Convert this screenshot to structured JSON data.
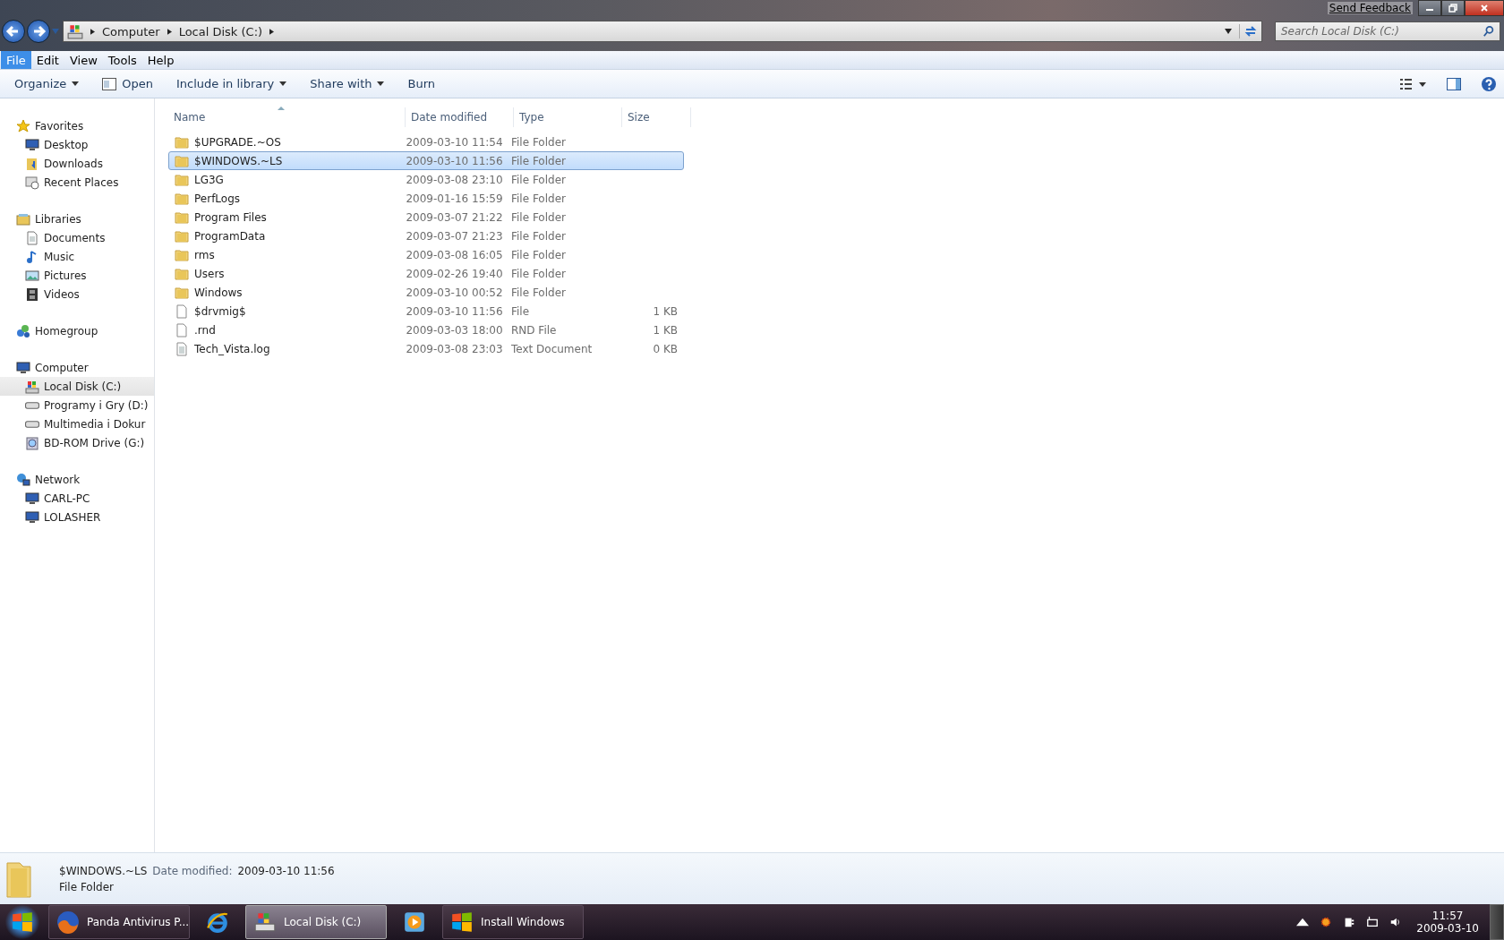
{
  "title_bar": {
    "feedback_link": "Send Feedback"
  },
  "address_bar": {
    "crumbs": [
      "Computer",
      "Local Disk (C:)"
    ]
  },
  "search": {
    "placeholder": "Search Local Disk (C:)"
  },
  "menu": [
    {
      "label": "File",
      "selected": true
    },
    {
      "label": "Edit",
      "selected": false
    },
    {
      "label": "View",
      "selected": false
    },
    {
      "label": "Tools",
      "selected": false
    },
    {
      "label": "Help",
      "selected": false
    }
  ],
  "toolbar": [
    {
      "label": "Organize",
      "kind": "dropdown"
    },
    {
      "label": "Open",
      "kind": "open"
    },
    {
      "label": "Include in library",
      "kind": "dropdown"
    },
    {
      "label": "Share with",
      "kind": "dropdown"
    },
    {
      "label": "Burn",
      "kind": "plain"
    }
  ],
  "sidebar": [
    {
      "label": "Favorites",
      "kind": "star",
      "children": [
        {
          "label": "Desktop",
          "kind": "desktop",
          "selected": false
        },
        {
          "label": "Downloads",
          "kind": "downloads",
          "selected": false
        },
        {
          "label": "Recent Places",
          "kind": "recent",
          "selected": false
        }
      ]
    },
    {
      "label": "Libraries",
      "kind": "library",
      "children": [
        {
          "label": "Documents",
          "kind": "document",
          "selected": false
        },
        {
          "label": "Music",
          "kind": "music",
          "selected": false
        },
        {
          "label": "Pictures",
          "kind": "picture",
          "selected": false
        },
        {
          "label": "Videos",
          "kind": "video",
          "selected": false
        }
      ]
    },
    {
      "label": "Homegroup",
      "kind": "homegroup"
    },
    {
      "label": "Computer",
      "kind": "computer",
      "children": [
        {
          "label": "Local Disk (C:)",
          "kind": "system-drive",
          "selected": true
        },
        {
          "label": "Programy i Gry (D:)",
          "kind": "drive",
          "selected": false
        },
        {
          "label": "Multimedia i Dokur",
          "kind": "drive",
          "selected": false
        },
        {
          "label": "BD-ROM Drive (G:)",
          "kind": "optical",
          "selected": false
        }
      ]
    },
    {
      "label": "Network",
      "kind": "network",
      "children": [
        {
          "label": "CARL-PC",
          "kind": "computer",
          "selected": false
        },
        {
          "label": "LOLASHER",
          "kind": "computer",
          "selected": false
        }
      ]
    }
  ],
  "table": {
    "columns": [
      "Name",
      "Date modified",
      "Type",
      "Size"
    ],
    "rows": [
      {
        "name": "$UPGRADE.~OS",
        "date": "2009-03-10 11:54",
        "type": "File Folder",
        "size": "",
        "kind": "folder",
        "selected": false
      },
      {
        "name": "$WINDOWS.~LS",
        "date": "2009-03-10 11:56",
        "type": "File Folder",
        "size": "",
        "kind": "folder",
        "selected": true
      },
      {
        "name": "LG3G",
        "date": "2009-03-08 23:10",
        "type": "File Folder",
        "size": "",
        "kind": "folder",
        "selected": false
      },
      {
        "name": "PerfLogs",
        "date": "2009-01-16 15:59",
        "type": "File Folder",
        "size": "",
        "kind": "folder",
        "selected": false
      },
      {
        "name": "Program Files",
        "date": "2009-03-07 21:22",
        "type": "File Folder",
        "size": "",
        "kind": "folder",
        "selected": false
      },
      {
        "name": "ProgramData",
        "date": "2009-03-07 21:23",
        "type": "File Folder",
        "size": "",
        "kind": "folder",
        "selected": false
      },
      {
        "name": "rms",
        "date": "2009-03-08 16:05",
        "type": "File Folder",
        "size": "",
        "kind": "folder",
        "selected": false
      },
      {
        "name": "Users",
        "date": "2009-02-26 19:40",
        "type": "File Folder",
        "size": "",
        "kind": "folder",
        "selected": false
      },
      {
        "name": "Windows",
        "date": "2009-03-10 00:52",
        "type": "File Folder",
        "size": "",
        "kind": "folder",
        "selected": false
      },
      {
        "name": "$drvmig$",
        "date": "2009-03-10 11:56",
        "type": "File",
        "size": "1 KB",
        "kind": "file",
        "selected": false
      },
      {
        "name": ".rnd",
        "date": "2009-03-03 18:00",
        "type": "RND File",
        "size": "1 KB",
        "kind": "file",
        "selected": false
      },
      {
        "name": "Tech_Vista.log",
        "date": "2009-03-08 23:03",
        "type": "Text Document",
        "size": "0 KB",
        "kind": "text",
        "selected": false
      }
    ]
  },
  "details": {
    "name": "$WINDOWS.~LS",
    "date_label": "Date modified:",
    "date": "2009-03-10 11:56",
    "type": "File Folder"
  },
  "taskbar": [
    {
      "label": "Panda Antivirus P...",
      "kind": "firefox",
      "selected": false
    },
    {
      "kind": "ie",
      "selected": false
    },
    {
      "label": "Local Disk (C:)",
      "kind": "explorer",
      "selected": true
    },
    {
      "kind": "media",
      "selected": false
    },
    {
      "label": "Install Windows",
      "kind": "windows",
      "selected": false
    }
  ],
  "clock": {
    "time": "11:57",
    "date": "2009-03-10"
  }
}
